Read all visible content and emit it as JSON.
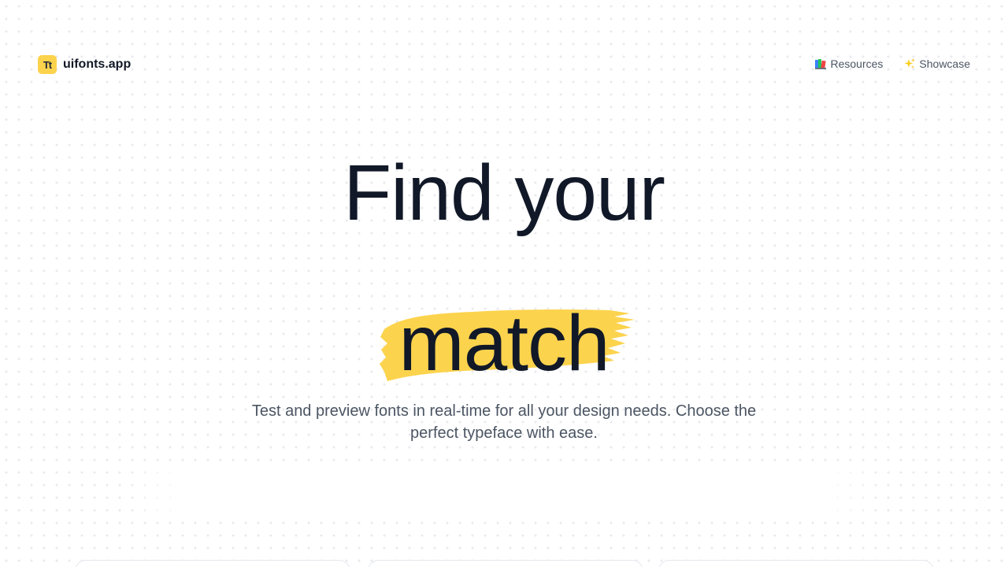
{
  "brand": {
    "mark": "Tt",
    "name": "uifonts.app",
    "accent": "#fcd34d"
  },
  "nav": {
    "items": [
      {
        "label": "Resources",
        "icon": "books-icon"
      },
      {
        "label": "Showcase",
        "icon": "sparkles-icon"
      }
    ]
  },
  "hero": {
    "line1": "Find your",
    "line2": "match",
    "subtitle": "Test and preview fonts in real-time for all your design needs. Choose the perfect typeface with ease.",
    "highlight_color": "#fcd34d",
    "text_color": "#111827"
  }
}
